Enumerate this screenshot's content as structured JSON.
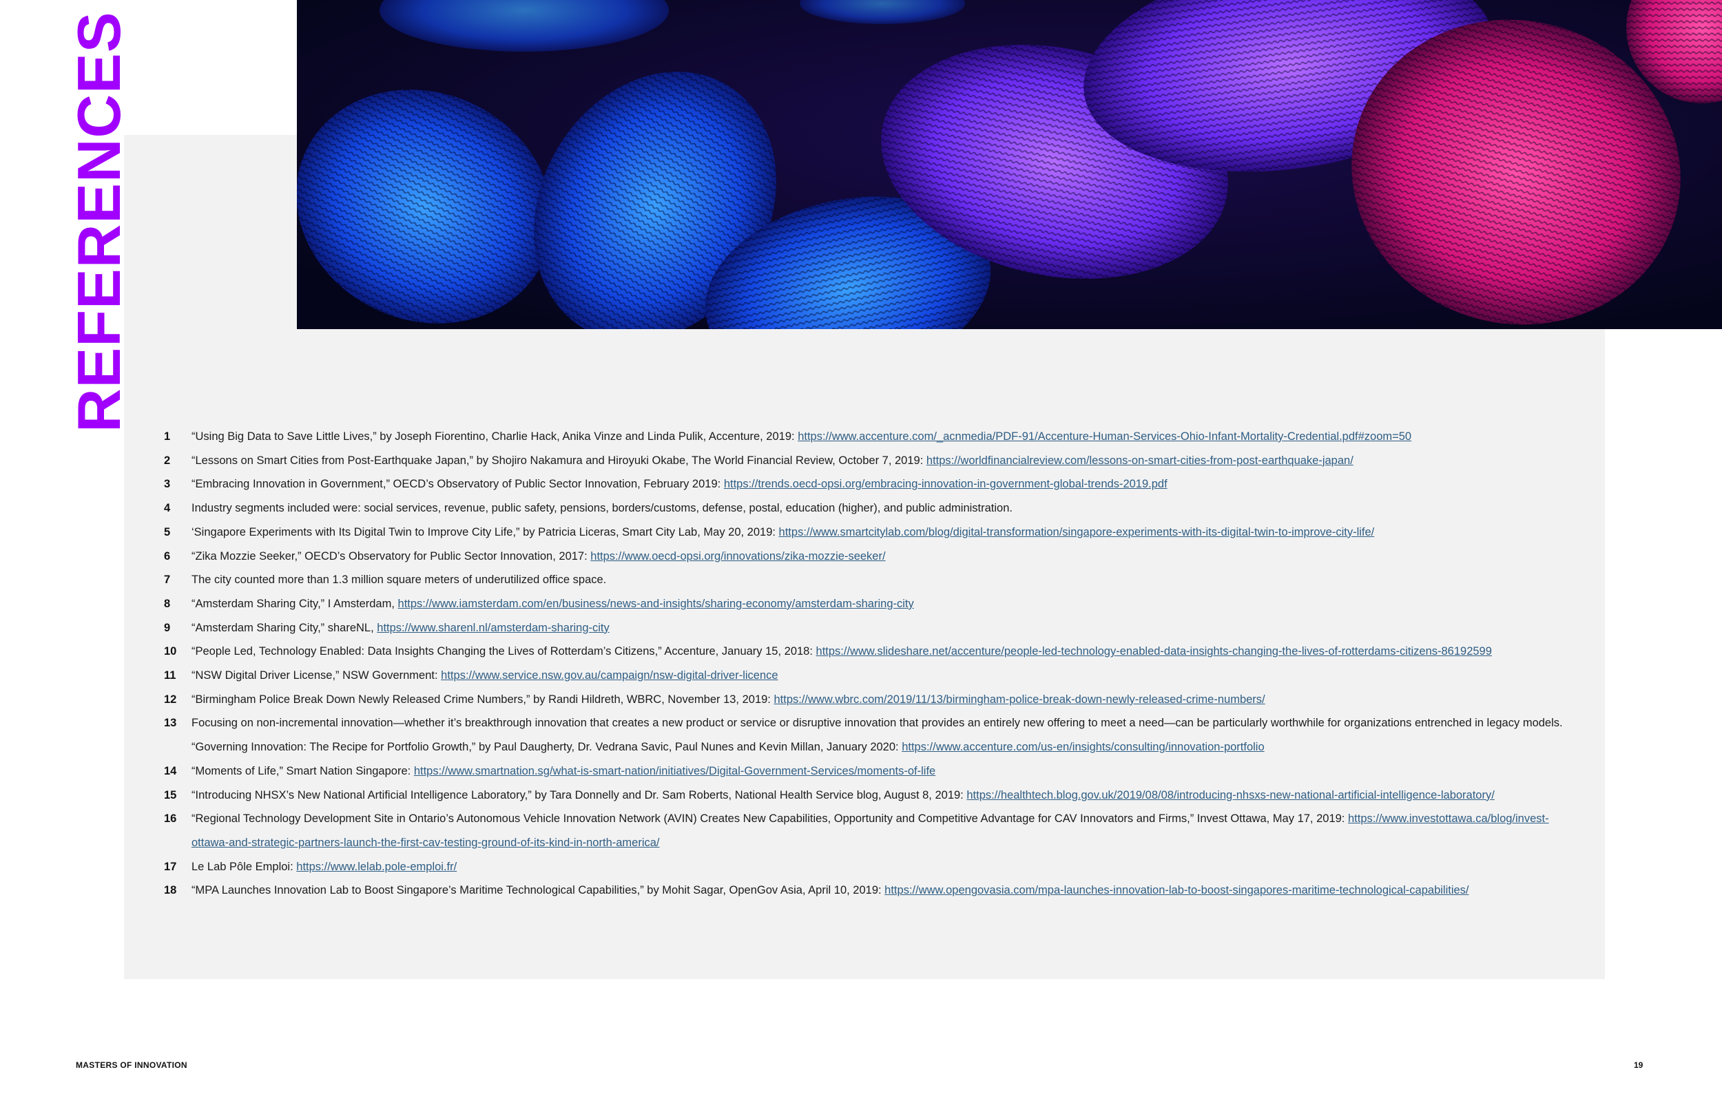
{
  "page": {
    "section_title": "REFERENCES",
    "footer_title": "MASTERS OF INNOVATION",
    "page_number": "19",
    "accent_color": "#a100ff",
    "link_color": "#2f5d83",
    "hero_image": "fingerprints-blue-pink-photo"
  },
  "references": [
    {
      "num": "1",
      "text": "“Using Big Data to Save Little Lives,” by Joseph Fiorentino, Charlie Hack, Anika Vinze and Linda Pulik, Accenture, 2019: ",
      "link": "https://www.accenture.com/_acnmedia/PDF-91/Accenture-Human-Services-Ohio-Infant-Mortality-Credential.pdf#zoom=50"
    },
    {
      "num": "2",
      "text": "“Lessons on Smart Cities from Post-Earthquake Japan,” by Shojiro Nakamura and Hiroyuki Okabe, The World Financial Review, October 7, 2019: ",
      "link": "https://worldfinancialreview.com/lessons-on-smart-cities-from-post-earthquake-japan/"
    },
    {
      "num": "3",
      "text": "“Embracing Innovation in Government,” OECD’s Observatory of Public Sector Innovation, February 2019: ",
      "link": "https://trends.oecd-opsi.org/embracing-innovation-in-government-global-trends-2019.pdf"
    },
    {
      "num": "4",
      "text": "Industry segments included were: social services, revenue, public safety, pensions, borders/customs, defense, postal, education (higher), and public administration.",
      "link": ""
    },
    {
      "num": "5",
      "text": "‘Singapore Experiments with Its Digital Twin to Improve City Life,” by Patricia Liceras, Smart City Lab, May 20, 2019: ",
      "link": "https://www.smartcitylab.com/blog/digital-transformation/singapore-experiments-with-its-digital-twin-to-improve-city-life/"
    },
    {
      "num": "6",
      "text": "“Zika Mozzie Seeker,” OECD’s Observatory for Public Sector Innovation, 2017:  ",
      "link": "https://www.oecd-opsi.org/innovations/zika-mozzie-seeker/"
    },
    {
      "num": "7",
      "text": "The city counted more than 1.3 million square meters of underutilized office space.",
      "link": ""
    },
    {
      "num": "8",
      "text": "“Amsterdam Sharing City,” I Amsterdam, ",
      "link": "https://www.iamsterdam.com/en/business/news-and-insights/sharing-economy/amsterdam-sharing-city"
    },
    {
      "num": "9",
      "text": "“Amsterdam Sharing City,” shareNL, ",
      "link": "https://www.sharenl.nl/amsterdam-sharing-city"
    },
    {
      "num": "10",
      "text": "“People Led, Technology Enabled: Data Insights Changing the Lives of Rotterdam’s Citizens,” Accenture, January 15, 2018: ",
      "link": "https://www.slideshare.net/accenture/people-led-technology-enabled-data-insights-changing-the-lives-of-rotterdams-citizens-86192599"
    },
    {
      "num": "11",
      "text": "“NSW Digital Driver License,” NSW Government: ",
      "link": "https://www.service.nsw.gov.au/campaign/nsw-digital-driver-licence"
    },
    {
      "num": "12",
      "text": "“Birmingham Police Break Down Newly Released Crime Numbers,” by Randi Hildreth, WBRC, November 13, 2019: ",
      "link": "https://www.wbrc.com/2019/11/13/birmingham-police-break-down-newly-released-crime-numbers/"
    },
    {
      "num": "13",
      "text": "Focusing on non-incremental innovation—whether it’s breakthrough innovation that creates a new product or service or disruptive innovation that provides an entirely new offering to meet a need—can be particularly worthwhile for organizations entrenched in legacy models. “Governing Innovation: The Recipe for Portfolio Growth,” by Paul Daugherty, Dr. Vedrana Savic, Paul Nunes and Kevin Millan, January 2020: ",
      "link": "https://www.accenture.com/us-en/insights/consulting/innovation-portfolio"
    },
    {
      "num": "14",
      "text": "“Moments of Life,” Smart Nation Singapore: ",
      "link": "https://www.smartnation.sg/what-is-smart-nation/initiatives/Digital-Government-Services/moments-of-life"
    },
    {
      "num": "15",
      "text": "“Introducing NHSX’s New National Artificial Intelligence Laboratory,” by Tara Donnelly and Dr. Sam Roberts, National Health Service blog, August 8, 2019: ",
      "link": "https://healthtech.blog.gov.uk/2019/08/08/introducing-nhsxs-new-national-artificial-intelligence-laboratory/"
    },
    {
      "num": "16",
      "text": "“Regional Technology Development Site in Ontario’s Autonomous Vehicle Innovation Network (AVIN) Creates New Capabilities, Opportunity and Competitive Advantage for CAV Innovators and Firms,” Invest Ottawa, May 17, 2019: ",
      "link": "https://www.investottawa.ca/blog/invest-ottawa-and-strategic-partners-launch-the-first-cav-testing-ground-of-its-kind-in-north-america/"
    },
    {
      "num": "17",
      "text": "Le Lab Pôle Emploi: ",
      "link": "https://www.lelab.pole-emploi.fr/"
    },
    {
      "num": "18",
      "text": "“MPA Launches Innovation Lab to Boost Singapore’s Maritime Technological Capabilities,” by Mohit Sagar, OpenGov Asia, April 10, 2019: ",
      "link": "https://www.opengovasia.com/mpa-launches-innovation-lab-to-boost-singapores-maritime-technological-capabilities/"
    }
  ]
}
